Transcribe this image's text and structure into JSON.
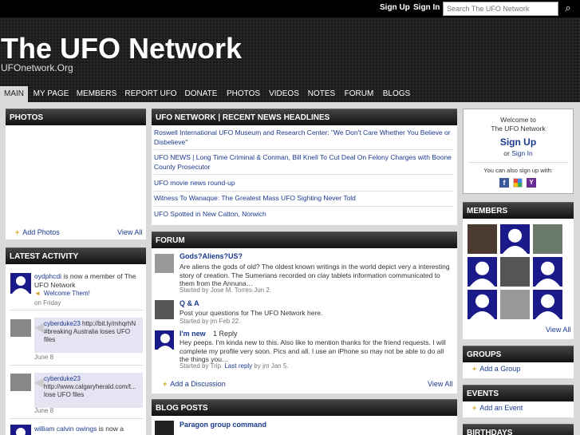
{
  "topbar": {
    "signup": "Sign Up",
    "signin": "Sign In",
    "search_placeholder": "Search The UFO Network"
  },
  "header": {
    "title": "The UFO Network",
    "subtitle": "UFOnetwork.Org"
  },
  "nav": [
    "MAIN",
    "MY PAGE",
    "MEMBERS",
    "REPORT UFO",
    "DONATE",
    "PHOTOS",
    "VIDEOS",
    "NOTES",
    "FORUM",
    "BLOGS"
  ],
  "photos": {
    "title": "PHOTOS",
    "add": "Add Photos",
    "view_all": "View All"
  },
  "activity": {
    "title": "LATEST ACTIVITY",
    "items": [
      {
        "user": "oydphcdi",
        "text": " is now a member of The UFO Network",
        "welcome": "Welcome Them!",
        "date": "on Friday"
      },
      {
        "user": "cyberduke23",
        "text": " http://bit.ly/mhqrhN #breaking Australia loses UFO files",
        "date": "June 8"
      },
      {
        "user": "cyberduke23",
        "text": " http://www.calgaryherald.com/t... lose UFO files",
        "date": "June 8"
      },
      {
        "user": "william calvin owings",
        "text": " is now a"
      }
    ]
  },
  "news": {
    "title": "UFO NETWORK | RECENT NEWS HEADLINES",
    "items": [
      "Roswell International UFO Museum and Research Center: \"We Don't Care Whether You Believe or Disbelieve\"",
      "UFO NEWS | Long Time Criminal & Conman, Bill Knell To Cut Deal On Felony Charges with Boone County Prosecutor",
      "UFO movie news round-up",
      "Witness To Wanaque: The Greatest Mass UFO Sighting Never Told",
      "UFO Spotted in New Catton, Norwich"
    ]
  },
  "forum": {
    "title": "FORUM",
    "posts": [
      {
        "title": "Gods?Aliens?US?",
        "body": "Are aliens the gods of old? The oldest known writings in the world depict very a interesting story of creation. The Sumerians recorded on clay tablets information communicated to them from the Annuna…",
        "meta": "Started by Jose M. Torres Jun 2."
      },
      {
        "title": "Q & A",
        "body": "Post your questions for The UFO Network here.",
        "meta": "Started by jm Feb 22."
      },
      {
        "title": "I'm new",
        "replies": "1 Reply",
        "body": "Hey peeps. I'm kinda new to this. Also like to mention thanks for the friend requests. I will complete my profile very soon. Pics and all. I use an iPhone so may not be able to do all the things you…",
        "meta": "Started by Trip.",
        "last_reply": "Last reply",
        "last_by": " by jm Jan 5."
      }
    ],
    "add": "Add a Discussion",
    "view_all": "View All"
  },
  "blog": {
    "title": "BLOG POSTS",
    "first": "Paragon group command"
  },
  "welcome": {
    "line1": "Welcome to",
    "line2": "The UFO Network",
    "signup": "Sign Up",
    "or": "or ",
    "signin": "Sign In",
    "also": "You can also sign up with:"
  },
  "members": {
    "title": "MEMBERS",
    "view_all": "View All"
  },
  "groups": {
    "title": "GROUPS",
    "add": "Add a Group"
  },
  "events": {
    "title": "EVENTS",
    "add": "Add an Event"
  },
  "birthdays": {
    "title": "BIRTHDAYS"
  }
}
